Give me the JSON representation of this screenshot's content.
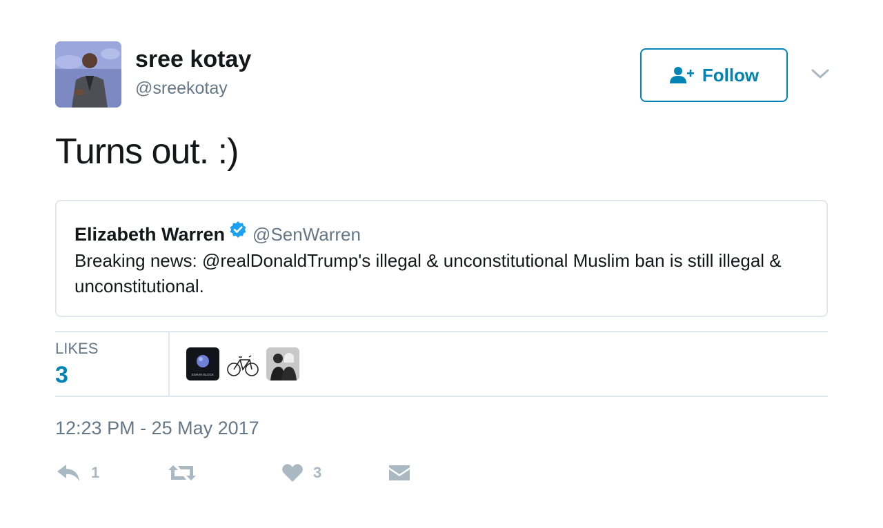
{
  "author": {
    "name": "sree kotay",
    "handle": "@sreekotay"
  },
  "follow_button": {
    "label": "Follow"
  },
  "tweet": {
    "text": "Turns out. :)"
  },
  "quoted_tweet": {
    "name": "Elizabeth Warren",
    "handle": "@SenWarren",
    "text": "Breaking news: @realDonaldTrump's illegal & unconstitutional Muslim ban is still illegal & unconstitutional."
  },
  "likes": {
    "label": "LIKES",
    "count": "3",
    "liker_avatar_text": "ESHAN BLOCK"
  },
  "timestamp": "12:23 PM - 25 May 2017",
  "actions": {
    "reply_count": "1",
    "retweet_count": "",
    "like_count": "3"
  },
  "colors": {
    "accent": "#0084b4",
    "verified": "#1da1f2",
    "muted": "#657786",
    "icon_gray": "#aab8c2",
    "border": "#e1e8ed"
  },
  "icons": [
    "follow-person-plus-icon",
    "chevron-down-icon",
    "verified-badge-icon",
    "reply-icon",
    "retweet-icon",
    "heart-icon",
    "envelope-icon"
  ]
}
